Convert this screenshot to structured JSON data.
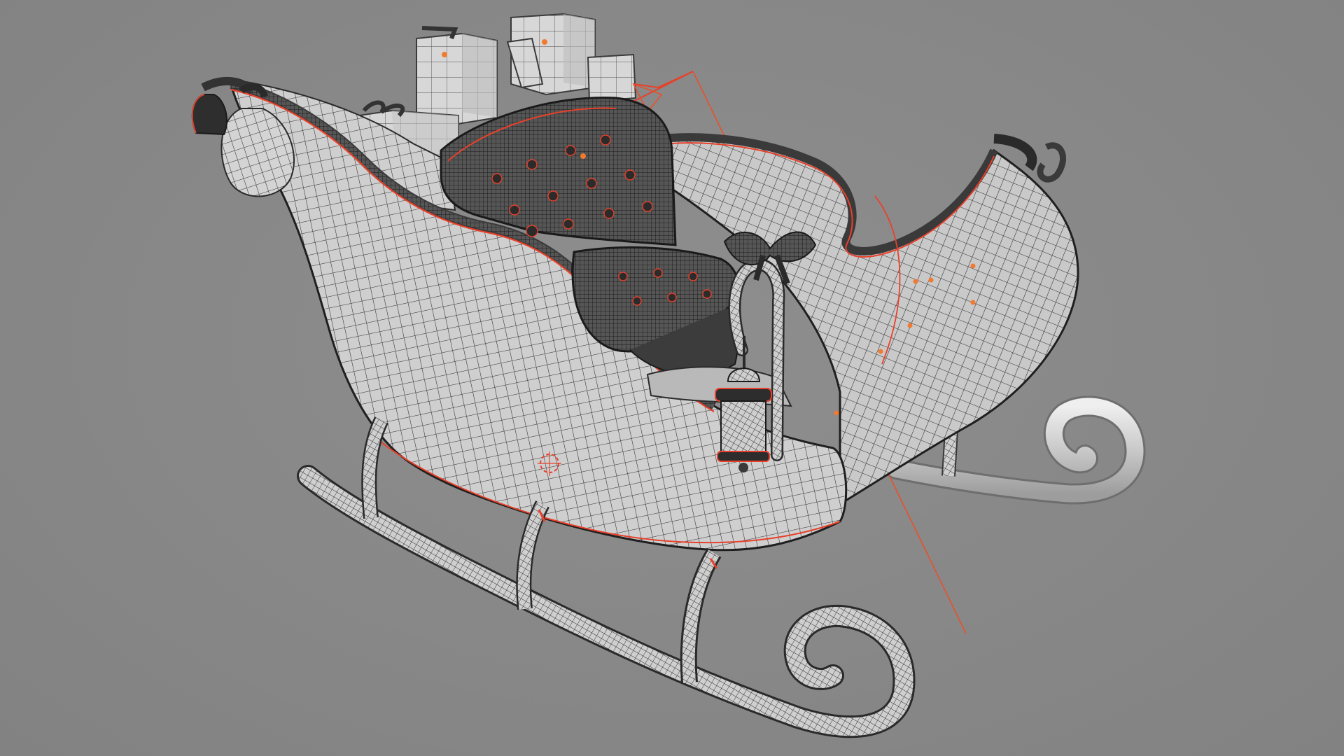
{
  "viewport": {
    "background_color": "#878787",
    "display_mode": "wireframe-on-shaded",
    "model": "sleigh"
  },
  "colors": {
    "mesh_fill": "#d2d2d2",
    "mesh_dark": "#4a4a4a",
    "wire": "#2a2a2a",
    "seam_edges": "#e8402a",
    "origin_marker": "#f07a30"
  },
  "objects": [
    {
      "name_icon": "sleigh-body-mesh"
    },
    {
      "name_icon": "tufted-seat-mesh"
    },
    {
      "name_icon": "runner-front-mesh"
    },
    {
      "name_icon": "runner-back-mesh"
    },
    {
      "name_icon": "gift-box-mesh"
    },
    {
      "name_icon": "gift-sack-mesh"
    },
    {
      "name_icon": "lantern-mesh"
    },
    {
      "name_icon": "candy-cane-bow-mesh"
    },
    {
      "name_icon": "bell-mesh"
    },
    {
      "name_icon": "camera-helper"
    },
    {
      "name_icon": "3d-cursor"
    }
  ]
}
